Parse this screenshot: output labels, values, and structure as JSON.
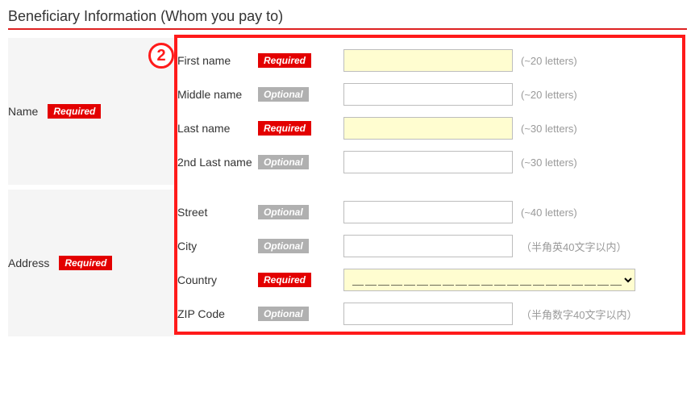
{
  "title": "Beneficiary Information (Whom you pay to)",
  "badges": {
    "required": "Required",
    "optional": "Optional"
  },
  "annotation": {
    "num": "2"
  },
  "sections": {
    "name": {
      "label": "Name",
      "required": true,
      "rows": {
        "first": {
          "label": "First name",
          "required": true,
          "hint": "(~20 letters)",
          "value": ""
        },
        "middle": {
          "label": "Middle name",
          "required": false,
          "hint": "(~20 letters)",
          "value": ""
        },
        "last": {
          "label": "Last name",
          "required": true,
          "hint": "(~30 letters)",
          "value": ""
        },
        "last2": {
          "label": "2nd Last name",
          "required": false,
          "hint": "(~30 letters)",
          "value": ""
        }
      }
    },
    "address": {
      "label": "Address",
      "required": true,
      "rows": {
        "street": {
          "label": "Street",
          "required": false,
          "hint": "(~40 letters)",
          "value": ""
        },
        "city": {
          "label": "City",
          "required": false,
          "hint": "（半角英40文字以内）",
          "value": ""
        },
        "country": {
          "label": "Country",
          "required": true,
          "hint": "",
          "selected": "＿＿＿＿＿＿＿＿＿＿＿＿＿＿＿＿＿＿＿＿＿＿＿＿＿"
        },
        "zip": {
          "label": "ZIP Code",
          "required": false,
          "hint": "（半角数字40文字以内）",
          "value": ""
        }
      }
    }
  }
}
